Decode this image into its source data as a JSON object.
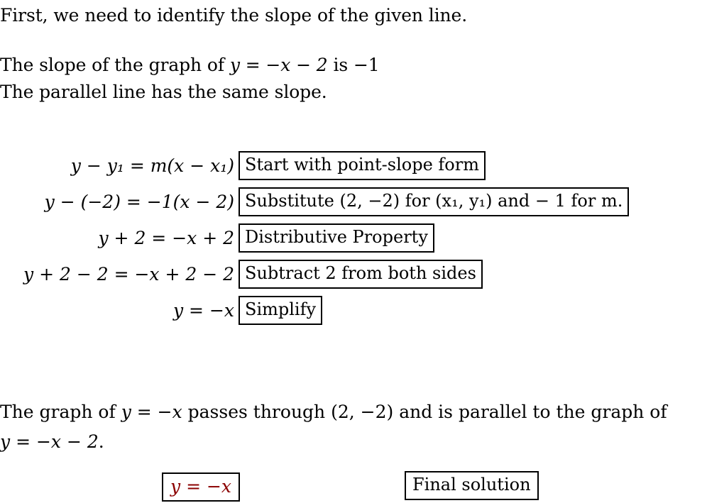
{
  "intro": {
    "line1": "First, we need to identify the slope of the given line."
  },
  "slope_statement": {
    "line1_prefix": "The slope of the graph of ",
    "line1_equation": "y = −x − 2",
    "line1_suffix": " is ",
    "line1_slope": "−1",
    "line2": "The parallel line has the same slope."
  },
  "derivation": {
    "rows": [
      {
        "equation": "y − y₁ = m(x − x₁)",
        "equation_parts": {
          "lhs": "y − y",
          "lhs_sub": "1",
          "rel": " = ",
          "rhs": "m(x − x",
          "rhs_sub": "1",
          "rhs_tail": ")"
        },
        "reason": "Start with point-slope form"
      },
      {
        "equation": "y − (−2) = −1(x − 2)",
        "reason_prefix": "Substitute (2, −2) for (",
        "reason_sub1": "x₁",
        "reason_mid": ", ",
        "reason_sub2": "y₁",
        "reason_suffix": ") and − 1 for m.",
        "reason": "Substitute (2, −2) for (x₁, y₁) and − 1 for m."
      },
      {
        "equation": "y + 2 = −x + 2",
        "reason": "Distributive Property"
      },
      {
        "equation": "y + 2 − 2 = −x + 2 − 2",
        "reason": "Subtract 2 from both sides"
      },
      {
        "equation": "y = −x",
        "reason": "Simplify"
      }
    ]
  },
  "conclusion": {
    "line1_a": "The graph of ",
    "line1_eq": "y = −x",
    "line1_b": " passes through ",
    "line1_point": "(2, −2)",
    "line1_c": " and is parallel to the graph of",
    "line2_eq": "y = −x − 2",
    "line2_period": "."
  },
  "final": {
    "answer": "y = −x",
    "label": "Final solution",
    "answer_color": "#8b0000"
  }
}
